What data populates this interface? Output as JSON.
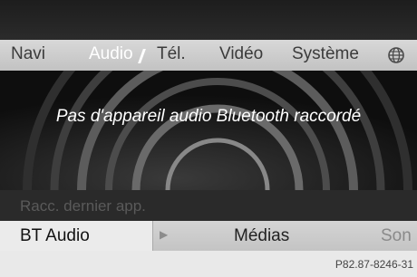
{
  "menu": {
    "items": [
      {
        "label": "Navi",
        "active": false
      },
      {
        "label": "Audio",
        "active": true
      },
      {
        "label": "Tél.",
        "active": false
      },
      {
        "label": "Vidéo",
        "active": false
      },
      {
        "label": "Système",
        "active": false
      }
    ],
    "globe_icon": "globe-icon"
  },
  "display": {
    "message": "Pas d'appareil audio Bluetooth raccordé",
    "shortcut": "Racc. dernier app."
  },
  "bottom": {
    "bt_audio": "BT Audio",
    "medias": "Médias",
    "son": "Son"
  },
  "footer": {
    "reference": "P82.87-8246-31"
  },
  "colors": {
    "active_menu": "#ffffff",
    "menu_text": "#3b3b3b",
    "menu_bg": "#cfcfcf"
  }
}
